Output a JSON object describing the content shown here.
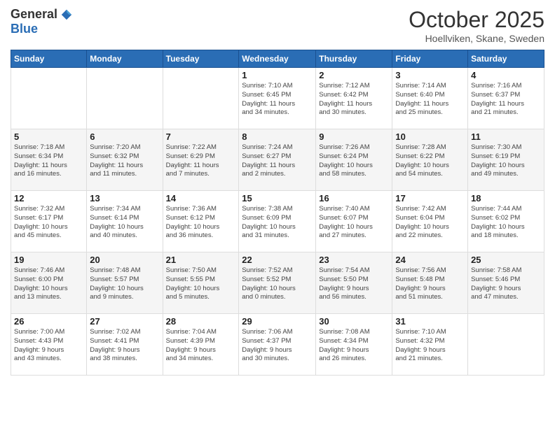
{
  "logo": {
    "general": "General",
    "blue": "Blue"
  },
  "header": {
    "month": "October 2025",
    "location": "Hoellviken, Skane, Sweden"
  },
  "weekdays": [
    "Sunday",
    "Monday",
    "Tuesday",
    "Wednesday",
    "Thursday",
    "Friday",
    "Saturday"
  ],
  "weeks": [
    [
      {
        "day": "",
        "info": ""
      },
      {
        "day": "",
        "info": ""
      },
      {
        "day": "",
        "info": ""
      },
      {
        "day": "1",
        "info": "Sunrise: 7:10 AM\nSunset: 6:45 PM\nDaylight: 11 hours\nand 34 minutes."
      },
      {
        "day": "2",
        "info": "Sunrise: 7:12 AM\nSunset: 6:42 PM\nDaylight: 11 hours\nand 30 minutes."
      },
      {
        "day": "3",
        "info": "Sunrise: 7:14 AM\nSunset: 6:40 PM\nDaylight: 11 hours\nand 25 minutes."
      },
      {
        "day": "4",
        "info": "Sunrise: 7:16 AM\nSunset: 6:37 PM\nDaylight: 11 hours\nand 21 minutes."
      }
    ],
    [
      {
        "day": "5",
        "info": "Sunrise: 7:18 AM\nSunset: 6:34 PM\nDaylight: 11 hours\nand 16 minutes."
      },
      {
        "day": "6",
        "info": "Sunrise: 7:20 AM\nSunset: 6:32 PM\nDaylight: 11 hours\nand 11 minutes."
      },
      {
        "day": "7",
        "info": "Sunrise: 7:22 AM\nSunset: 6:29 PM\nDaylight: 11 hours\nand 7 minutes."
      },
      {
        "day": "8",
        "info": "Sunrise: 7:24 AM\nSunset: 6:27 PM\nDaylight: 11 hours\nand 2 minutes."
      },
      {
        "day": "9",
        "info": "Sunrise: 7:26 AM\nSunset: 6:24 PM\nDaylight: 10 hours\nand 58 minutes."
      },
      {
        "day": "10",
        "info": "Sunrise: 7:28 AM\nSunset: 6:22 PM\nDaylight: 10 hours\nand 54 minutes."
      },
      {
        "day": "11",
        "info": "Sunrise: 7:30 AM\nSunset: 6:19 PM\nDaylight: 10 hours\nand 49 minutes."
      }
    ],
    [
      {
        "day": "12",
        "info": "Sunrise: 7:32 AM\nSunset: 6:17 PM\nDaylight: 10 hours\nand 45 minutes."
      },
      {
        "day": "13",
        "info": "Sunrise: 7:34 AM\nSunset: 6:14 PM\nDaylight: 10 hours\nand 40 minutes."
      },
      {
        "day": "14",
        "info": "Sunrise: 7:36 AM\nSunset: 6:12 PM\nDaylight: 10 hours\nand 36 minutes."
      },
      {
        "day": "15",
        "info": "Sunrise: 7:38 AM\nSunset: 6:09 PM\nDaylight: 10 hours\nand 31 minutes."
      },
      {
        "day": "16",
        "info": "Sunrise: 7:40 AM\nSunset: 6:07 PM\nDaylight: 10 hours\nand 27 minutes."
      },
      {
        "day": "17",
        "info": "Sunrise: 7:42 AM\nSunset: 6:04 PM\nDaylight: 10 hours\nand 22 minutes."
      },
      {
        "day": "18",
        "info": "Sunrise: 7:44 AM\nSunset: 6:02 PM\nDaylight: 10 hours\nand 18 minutes."
      }
    ],
    [
      {
        "day": "19",
        "info": "Sunrise: 7:46 AM\nSunset: 6:00 PM\nDaylight: 10 hours\nand 13 minutes."
      },
      {
        "day": "20",
        "info": "Sunrise: 7:48 AM\nSunset: 5:57 PM\nDaylight: 10 hours\nand 9 minutes."
      },
      {
        "day": "21",
        "info": "Sunrise: 7:50 AM\nSunset: 5:55 PM\nDaylight: 10 hours\nand 5 minutes."
      },
      {
        "day": "22",
        "info": "Sunrise: 7:52 AM\nSunset: 5:52 PM\nDaylight: 10 hours\nand 0 minutes."
      },
      {
        "day": "23",
        "info": "Sunrise: 7:54 AM\nSunset: 5:50 PM\nDaylight: 9 hours\nand 56 minutes."
      },
      {
        "day": "24",
        "info": "Sunrise: 7:56 AM\nSunset: 5:48 PM\nDaylight: 9 hours\nand 51 minutes."
      },
      {
        "day": "25",
        "info": "Sunrise: 7:58 AM\nSunset: 5:46 PM\nDaylight: 9 hours\nand 47 minutes."
      }
    ],
    [
      {
        "day": "26",
        "info": "Sunrise: 7:00 AM\nSunset: 4:43 PM\nDaylight: 9 hours\nand 43 minutes."
      },
      {
        "day": "27",
        "info": "Sunrise: 7:02 AM\nSunset: 4:41 PM\nDaylight: 9 hours\nand 38 minutes."
      },
      {
        "day": "28",
        "info": "Sunrise: 7:04 AM\nSunset: 4:39 PM\nDaylight: 9 hours\nand 34 minutes."
      },
      {
        "day": "29",
        "info": "Sunrise: 7:06 AM\nSunset: 4:37 PM\nDaylight: 9 hours\nand 30 minutes."
      },
      {
        "day": "30",
        "info": "Sunrise: 7:08 AM\nSunset: 4:34 PM\nDaylight: 9 hours\nand 26 minutes."
      },
      {
        "day": "31",
        "info": "Sunrise: 7:10 AM\nSunset: 4:32 PM\nDaylight: 9 hours\nand 21 minutes."
      },
      {
        "day": "",
        "info": ""
      }
    ]
  ]
}
